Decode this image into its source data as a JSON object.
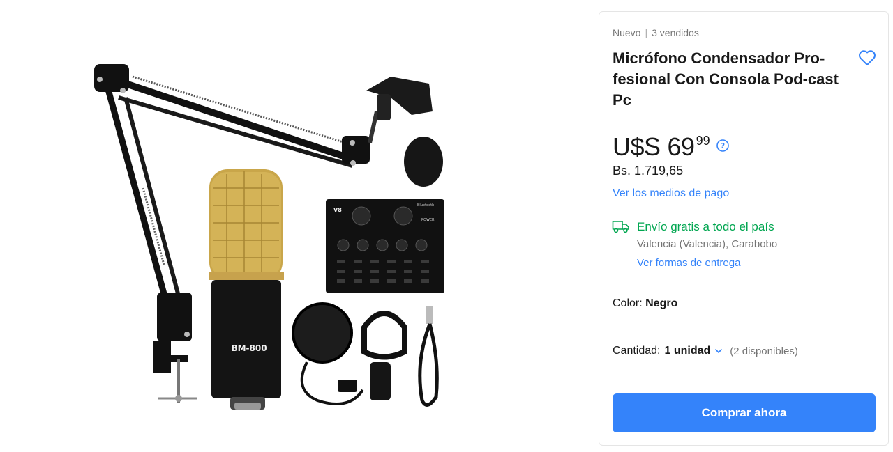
{
  "product": {
    "condition": "Nuevo",
    "sold": "3 vendidos",
    "title": "Micrófono Condensador Pro-fesional Con Consola Pod-cast Pc",
    "image_labels": {
      "mic_model": "BM-800",
      "console_model": "V8",
      "console_bluetooth": "Bluetooth",
      "console_power": "POWER"
    }
  },
  "price": {
    "currency": "U$S",
    "amount": "69",
    "cents": "99",
    "local": "Bs. 1.719,65",
    "payment_link": "Ver los medios de pago"
  },
  "shipping": {
    "title": "Envío gratis a todo el país",
    "location": "Valencia (Valencia), Carabobo",
    "delivery_link": "Ver formas de entrega"
  },
  "color": {
    "label": "Color: ",
    "value": "Negro"
  },
  "quantity": {
    "label": "Cantidad:",
    "value": "1 unidad",
    "available": "(2 disponibles)"
  },
  "actions": {
    "buy_now": "Comprar ahora"
  },
  "colors": {
    "accent": "#3483fa",
    "shipping_green": "#00a650"
  }
}
